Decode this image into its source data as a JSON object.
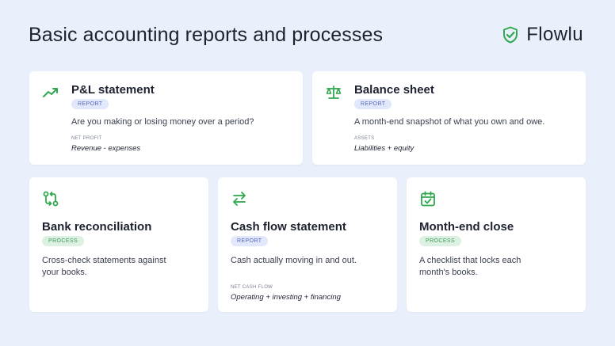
{
  "page": {
    "title": "Basic accounting reports and processes",
    "brand_name": "Flowlu",
    "accent": "#2fa84f"
  },
  "cards": [
    {
      "title": "P&L statement",
      "badge": "REPORT",
      "description": "Are you making or losing money over a period?",
      "kv_label": "NET PROFIT",
      "kv_value": "Revenue - expenses",
      "icon": "trending-up-icon"
    },
    {
      "title": "Balance sheet",
      "badge": "REPORT",
      "description": "A month-end snapshot of what you own and owe.",
      "kv_label": "ASSETS",
      "kv_value": "Liabilities + equity",
      "icon": "scale-icon"
    },
    {
      "title": "Bank reconciliation",
      "badge": "PROCESS",
      "description_lines": [
        "Cross-check statements against",
        "your books."
      ],
      "icon": "reconcile-icon"
    },
    {
      "title": "Cash flow statement",
      "badge": "REPORT",
      "description": "Cash actually moving in and out.",
      "kv_label": "NET CASH FLOW",
      "kv_value": "Operating + investing + financing",
      "icon": "transfer-arrows-icon"
    },
    {
      "title": "Month-end close",
      "badge": "PROCESS",
      "description_lines": [
        "A checklist that locks each",
        "month's books."
      ],
      "icon": "calendar-check-icon"
    }
  ]
}
